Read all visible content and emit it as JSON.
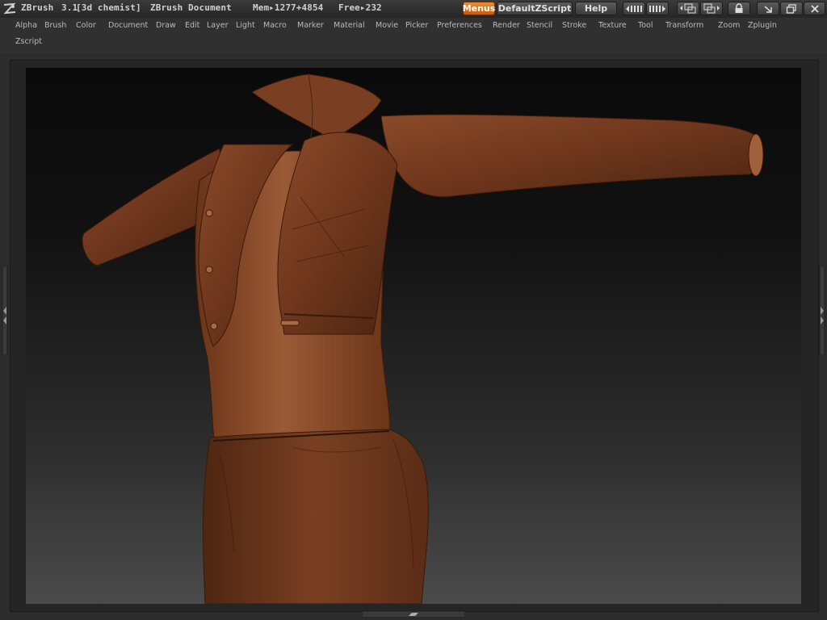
{
  "app": {
    "name": "ZBrush",
    "version": "3.1",
    "user": "[3d chemist]",
    "document": "ZBrush Document",
    "memory": "Mem▸1277+4854",
    "free": "Free▸232"
  },
  "toolbar": {
    "menus_label": "Menus",
    "script_label": "DefaultZScript",
    "help_label": "Help"
  },
  "menu": {
    "items": [
      "Alpha",
      "Brush",
      "Color",
      "Document",
      "Draw",
      "Edit",
      "Layer",
      "Light",
      "Macro",
      "Marker",
      "Material",
      "Movie",
      "Picker",
      "Preferences",
      "Render",
      "Stencil",
      "Stroke",
      "Texture",
      "Tool",
      "Transform",
      "Zoom",
      "Zplugin",
      "Zscript"
    ]
  },
  "icons": {
    "logo": "zbrush-logo-icon",
    "scroll_left": "scroll-left-icon",
    "scroll_right": "scroll-right-icon",
    "layout_prev": "layout-prev-icon",
    "layout_next": "layout-next-icon",
    "lock": "lock-icon",
    "minimize": "minimize-icon",
    "restore": "restore-icon",
    "close": "close-icon"
  },
  "colors": {
    "accent": "#e8741a",
    "leather": "#7a3f22",
    "background": "#2c2c2c"
  }
}
